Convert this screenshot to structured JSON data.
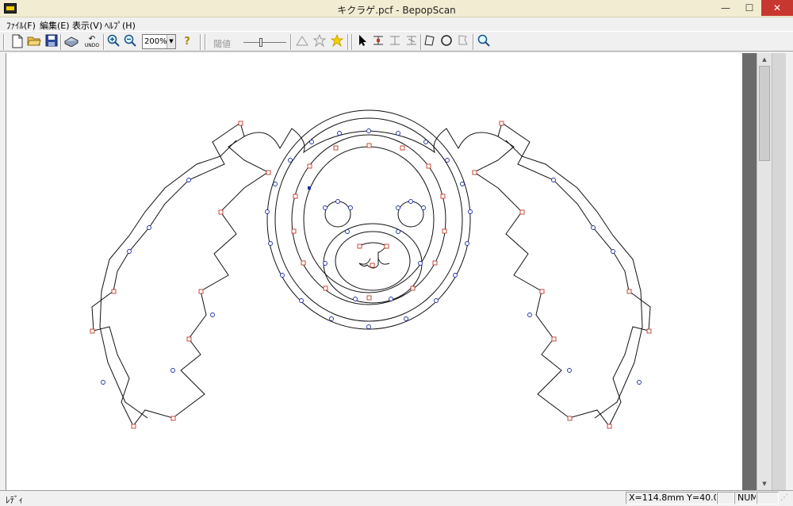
{
  "window": {
    "title": "キクラゲ.pcf - BepopScan",
    "min_label": "—",
    "max_label": "☐",
    "close_label": "✕"
  },
  "menu": [
    {
      "id": "file",
      "label": "ﾌｧｲﾙ(F)"
    },
    {
      "id": "edit",
      "label": "編集(E)"
    },
    {
      "id": "view",
      "label": "表示(V)"
    },
    {
      "id": "help",
      "label": "ﾍﾙﾌﾟ(H)"
    }
  ],
  "toolbar": {
    "new_icon": "new-file-icon",
    "open_icon": "open-folder-icon",
    "save_icon": "save-icon",
    "scan_icon": "scanner-icon",
    "undo_label": "UNDO",
    "zoom_in_icon": "zoom-in-icon",
    "zoom_out_icon": "zoom-out-icon",
    "zoom_value": "200%",
    "help_icon": "?",
    "threshold_label": "閾値",
    "threshold_level": 0.4,
    "colors": {
      "accent_yellow": "#f5d000",
      "point_red": "#c0392b",
      "point_blue": "#1f2fa8",
      "curve": "#111111"
    }
  },
  "status": {
    "text": "ﾚﾃﾞｨ",
    "coords": "X=114.8mm  Y=40.0mm",
    "panel_blank": "",
    "num": "NUM",
    "end": ""
  }
}
